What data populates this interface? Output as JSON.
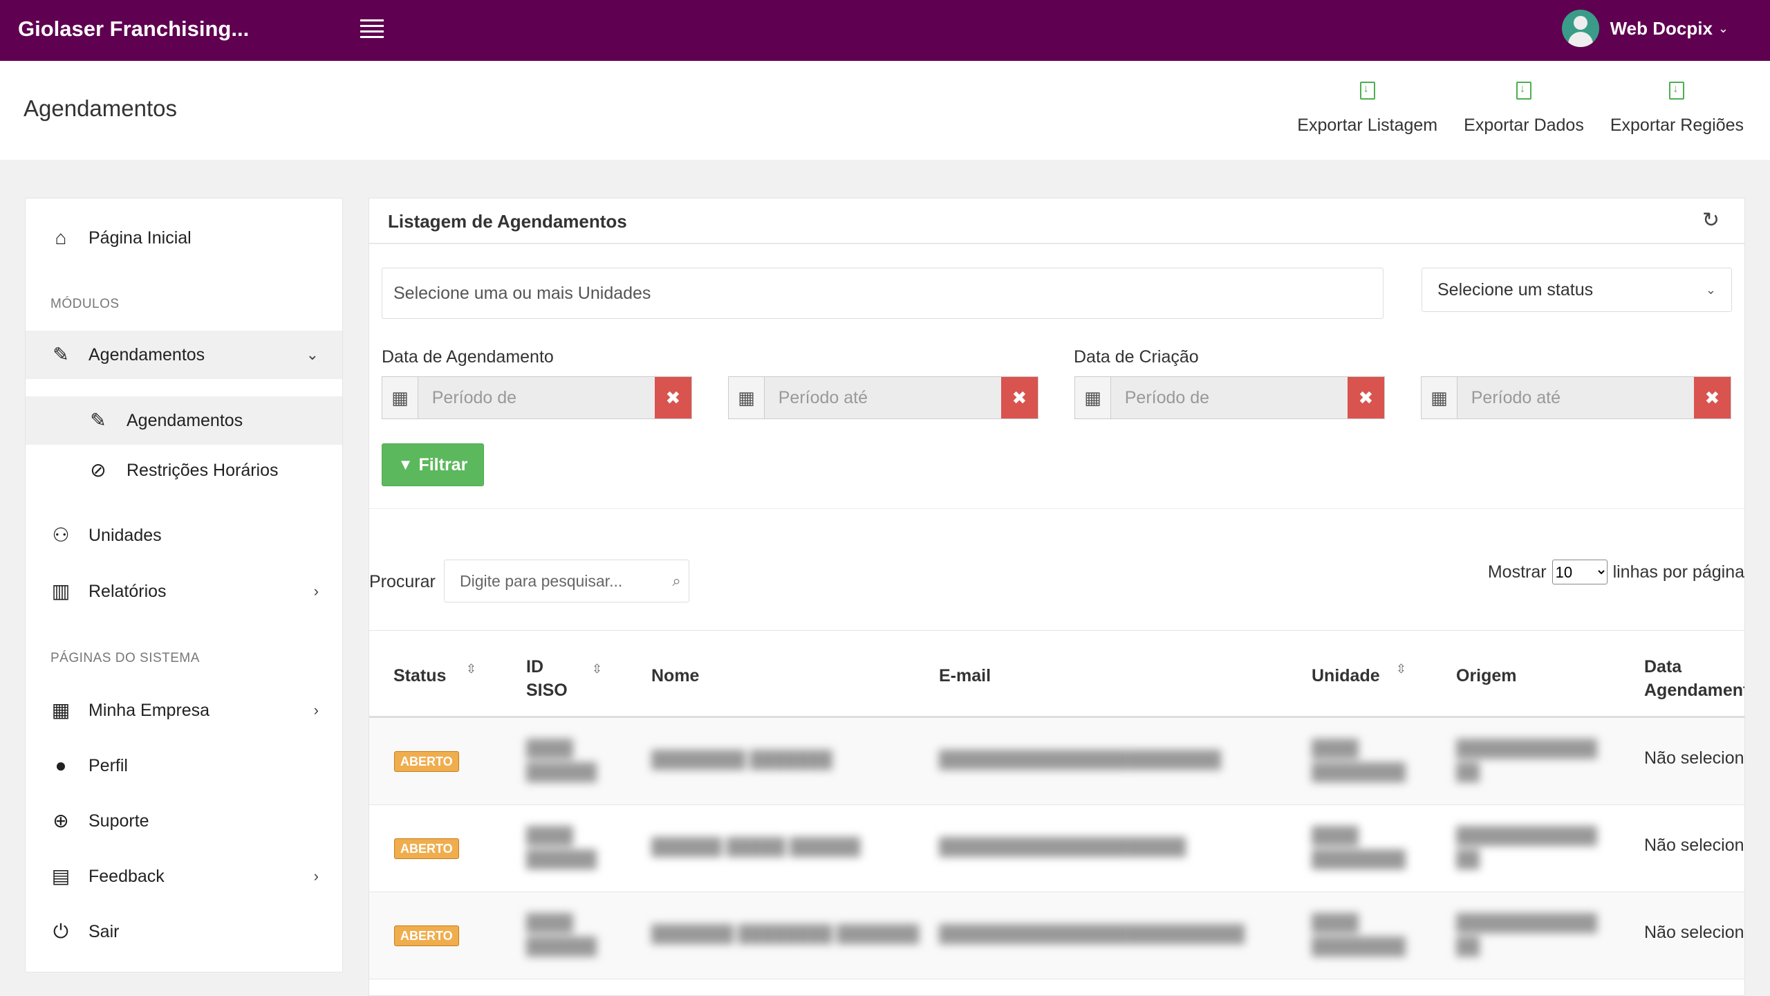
{
  "app": {
    "title": "Giolaser Franchising..."
  },
  "user": {
    "name": "Web Docpix"
  },
  "page": {
    "title": "Agendamentos"
  },
  "exports": [
    {
      "label": "Exportar Listagem"
    },
    {
      "label": "Exportar Dados"
    },
    {
      "label": "Exportar Regiões"
    }
  ],
  "sidebar": {
    "home": "Página Inicial",
    "modules_heading": "MÓDULOS",
    "agendamentos": "Agendamentos",
    "sub_agendamentos": "Agendamentos",
    "sub_restricoes": "Restrições Horários",
    "unidades": "Unidades",
    "relatorios": "Relatórios",
    "system_heading": "PÁGINAS DO SISTEMA",
    "minha_empresa": "Minha Empresa",
    "perfil": "Perfil",
    "suporte": "Suporte",
    "feedback": "Feedback",
    "sair": "Sair"
  },
  "panel": {
    "title": "Listagem de Agendamentos",
    "units_placeholder": "Selecione uma ou mais Unidades",
    "status_placeholder": "Selecione um status",
    "date_sched_label": "Data de Agendamento",
    "date_created_label": "Data de Criação",
    "from_placeholder": "Período de",
    "to_placeholder": "Período até",
    "filter_label": "Filtrar",
    "search_label": "Procurar",
    "search_placeholder": "Digite para pesquisar...",
    "show_label": "Mostrar",
    "show_value": "10",
    "rows_per_page": "linhas por página"
  },
  "table": {
    "headers": {
      "status": "Status",
      "id_line1": "ID",
      "id_line2": "SISO",
      "nome": "Nome",
      "email": "E-mail",
      "unidade": "Unidade",
      "origem": "Origem",
      "data_line1": "Data",
      "data_line2": "Agendamento"
    },
    "rows": [
      {
        "status": "ABERTO",
        "data": "Não selecionado"
      },
      {
        "status": "ABERTO",
        "data": "Não selecionado"
      },
      {
        "status": "ABERTO",
        "data": "Não selecionado"
      }
    ]
  },
  "colors": {
    "topbar": "#5f0050",
    "danger": "#d9534f",
    "success": "#5cb85c",
    "warning": "#f0ad4e"
  }
}
